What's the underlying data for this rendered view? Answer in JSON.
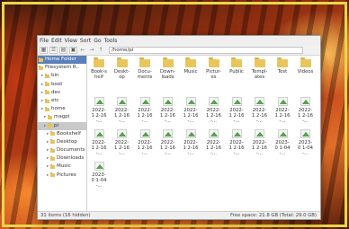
{
  "menubar": {
    "items": [
      "File",
      "Edit",
      "View",
      "Sort",
      "Go",
      "Tools"
    ]
  },
  "toolbar": {
    "path": "/home/pi"
  },
  "sidebar": {
    "items": [
      {
        "label": "Home Folder",
        "indent": 0,
        "state": "home"
      },
      {
        "label": "Filesystem R..",
        "indent": 0,
        "state": ""
      },
      {
        "label": "bin",
        "indent": 1,
        "state": ""
      },
      {
        "label": "boot",
        "indent": 1,
        "state": ""
      },
      {
        "label": "dev",
        "indent": 1,
        "state": ""
      },
      {
        "label": "etc",
        "indent": 1,
        "state": ""
      },
      {
        "label": "home",
        "indent": 1,
        "state": ""
      },
      {
        "label": "magpi",
        "indent": 2,
        "state": ""
      },
      {
        "label": "pi",
        "indent": 2,
        "state": "selected"
      },
      {
        "label": "Bookshelf",
        "indent": 3,
        "state": ""
      },
      {
        "label": "Desktop",
        "indent": 3,
        "state": ""
      },
      {
        "label": "Documents",
        "indent": 3,
        "state": ""
      },
      {
        "label": "Downloads",
        "indent": 3,
        "state": ""
      },
      {
        "label": "Music",
        "indent": 3,
        "state": ""
      },
      {
        "label": "Pictures",
        "indent": 3,
        "state": ""
      }
    ]
  },
  "folders": [
    "Book-shelf",
    "Deskt-op",
    "Docu-ments",
    "Down-loads",
    "Music",
    "Pictur-es",
    "Public",
    "Templ-ates",
    "Test",
    "Videos"
  ],
  "image_rows": [
    [
      "2022-1 2-16-...",
      "2022-1 2-16-...",
      "2022-1 2-16-...",
      "2022-1 2-16-...",
      "2022-1 2-16-...",
      "2022-1 2-16-...",
      "2022-1 2-16-...",
      "2022-1 2-16-...",
      "2022-1 2-16-...",
      "2022-1 2-16-..."
    ],
    [
      "2022-1 2-16-...",
      "2022-1 2-16-...",
      "2022-1 2-16-...",
      "2022-1 2-16-...",
      "2022-1 2-16-...",
      "2022-1 2-16-...",
      "2022-1 2-16-...",
      "2022-1 2-16-...",
      "2023-0 1-04-...",
      "2023-0 1-04-..."
    ],
    [
      "2023-0 1-04-..."
    ]
  ],
  "status": {
    "left": "31 items (16 hidden)",
    "right": "Free space: 21.8 GB (Total: 29.0 GB)"
  }
}
